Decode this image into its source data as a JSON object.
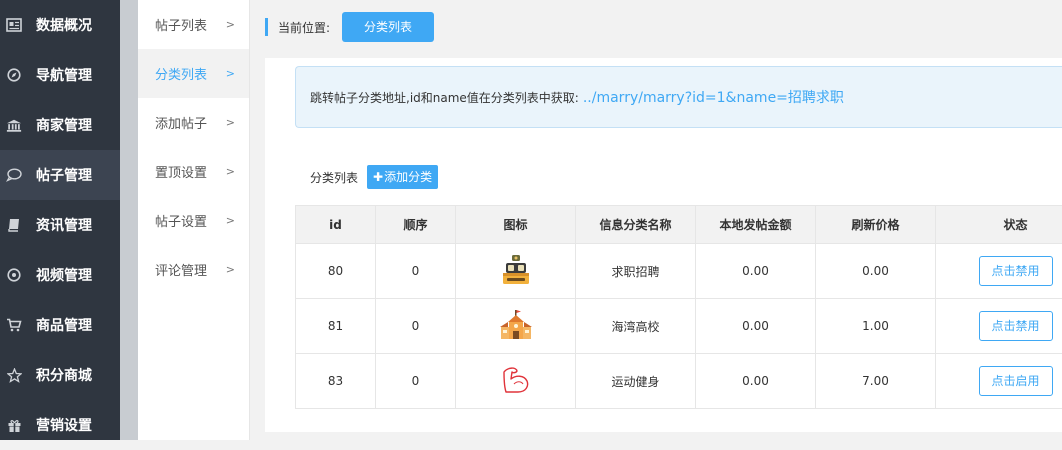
{
  "nav": {
    "items": [
      {
        "label": "数据概况",
        "icon": "dashboard-icon"
      },
      {
        "label": "导航管理",
        "icon": "compass-icon"
      },
      {
        "label": "商家管理",
        "icon": "bank-icon"
      },
      {
        "label": "帖子管理",
        "icon": "chat-bubble-icon"
      },
      {
        "label": "资讯管理",
        "icon": "book-icon"
      },
      {
        "label": "视频管理",
        "icon": "play-circle-icon"
      },
      {
        "label": "商品管理",
        "icon": "cart-icon"
      },
      {
        "label": "积分商城",
        "icon": "star-icon"
      },
      {
        "label": "营销设置",
        "icon": "gift-icon"
      }
    ],
    "active_index": 3
  },
  "subnav": {
    "items": [
      {
        "label": "帖子列表"
      },
      {
        "label": "分类列表"
      },
      {
        "label": "添加帖子"
      },
      {
        "label": "置顶设置"
      },
      {
        "label": "帖子设置"
      },
      {
        "label": "评论管理"
      }
    ],
    "active_index": 1
  },
  "breadcrumb": {
    "label": "当前位置:",
    "current": "分类列表"
  },
  "tip": {
    "text": "跳转帖子分类地址,id和name值在分类列表中获取:",
    "url": "../marry/marry?id=1&name=招聘求职"
  },
  "list": {
    "title": "分类列表",
    "add_label": "添加分类"
  },
  "table": {
    "headers": [
      "id",
      "顺序",
      "图标",
      "信息分类名称",
      "本地发帖金额",
      "刷新价格",
      "状态"
    ],
    "rows": [
      {
        "id": "80",
        "order": "0",
        "icon": "job-counter-icon",
        "name": "求职招聘",
        "post_amount": "0.00",
        "refresh_price": "0.00",
        "status": "点击禁用"
      },
      {
        "id": "81",
        "order": "0",
        "icon": "school-building-icon",
        "name": "海湾高校",
        "post_amount": "0.00",
        "refresh_price": "1.00",
        "status": "点击禁用"
      },
      {
        "id": "83",
        "order": "0",
        "icon": "flexed-arm-icon",
        "name": "运动健身",
        "post_amount": "0.00",
        "refresh_price": "7.00",
        "status": "点击启用"
      }
    ]
  },
  "colors": {
    "accent": "#3fa8f4",
    "nav_bg": "#2f3640"
  }
}
